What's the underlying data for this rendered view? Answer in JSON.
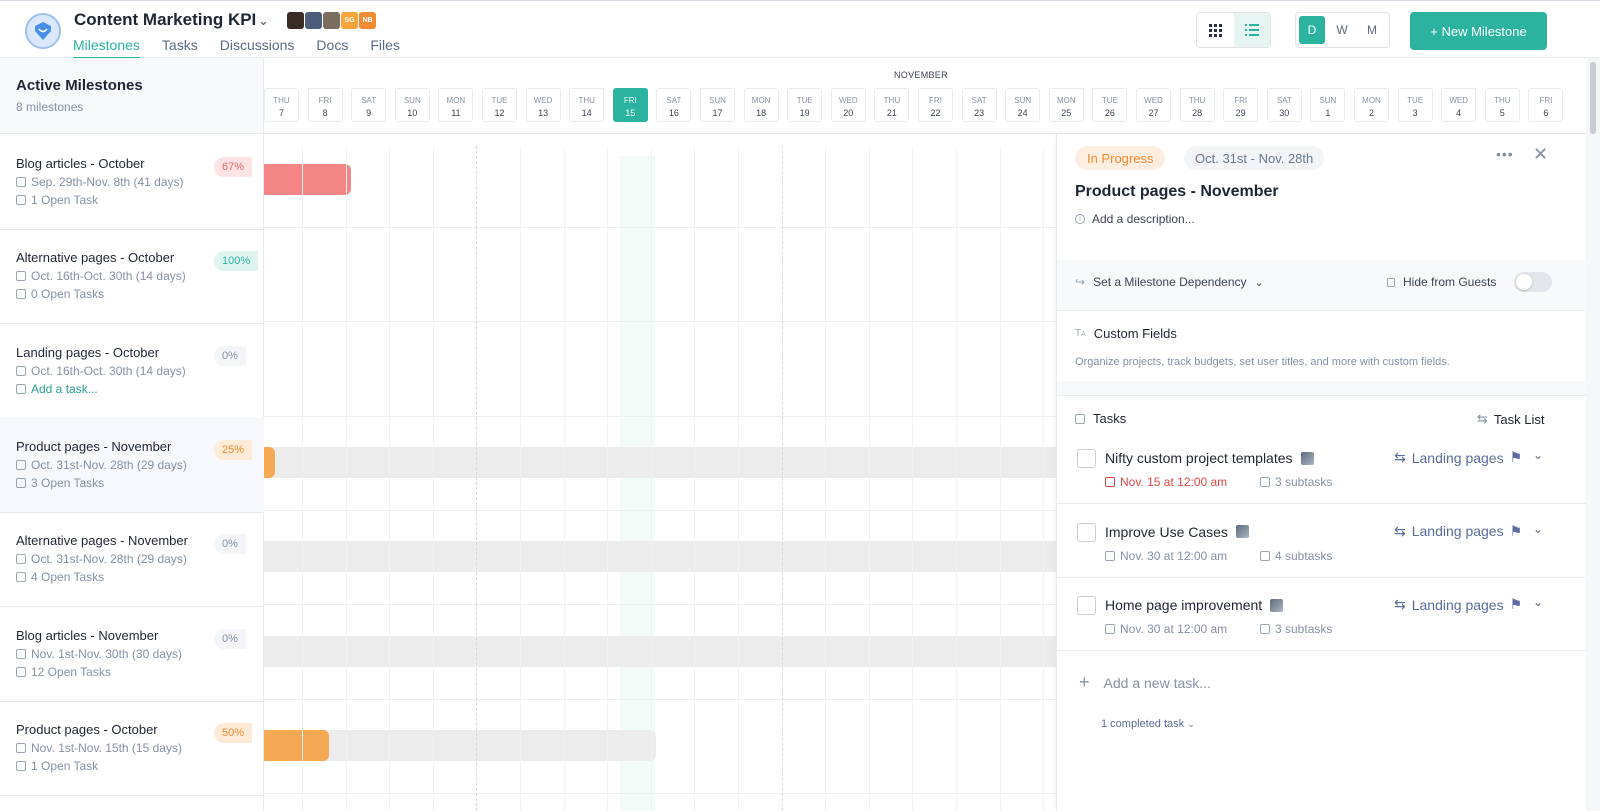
{
  "project": {
    "title": "Content Marketing KPI",
    "avatars": [
      {
        "initials": "",
        "color": "#3a2b25"
      },
      {
        "initials": "",
        "color": "#4b5d7a"
      },
      {
        "initials": "",
        "color": "#7a6d5f"
      },
      {
        "initials": "SG",
        "color": "#f6a33a"
      },
      {
        "initials": "NB",
        "color": "#f28a32"
      }
    ]
  },
  "nav": {
    "tabs": [
      {
        "label": "Milestones",
        "active": true
      },
      {
        "label": "Tasks",
        "active": false
      },
      {
        "label": "Discussions",
        "active": false
      },
      {
        "label": "Docs",
        "active": false
      },
      {
        "label": "Files",
        "active": false
      }
    ]
  },
  "toolbar": {
    "zoom": [
      "D",
      "W",
      "M"
    ],
    "zoom_selected": "D",
    "new_milestone": "+ New Milestone"
  },
  "sidebar": {
    "heading": "Active Milestones",
    "count": "8 milestones",
    "milestones": [
      {
        "name": "Blog articles - October",
        "dates": "Sep. 29th-Nov. 8th (41 days)",
        "tasks": "1 Open Task",
        "percent": "67%",
        "pct_bg": "#fde3e3",
        "pct_color": "#e86a6a",
        "bar_color": "#f48585",
        "bar_days": 2,
        "track_days": 0
      },
      {
        "name": "Alternative pages - October",
        "dates": "Oct. 16th-Oct. 30th (14 days)",
        "tasks": "0 Open Tasks",
        "percent": "100%",
        "pct_bg": "#dff4ef",
        "pct_color": "#2bb3a0",
        "bar_color": "#2bb3a0",
        "bar_days": 0,
        "track_days": 0
      },
      {
        "name": "Landing pages  - October",
        "dates": "Oct. 16th-Oct. 30th (14 days)",
        "tasks": "Add a task...",
        "task_is_link": true,
        "percent": "0%",
        "pct_bg": "#f3f5f8",
        "pct_color": "#8592a3",
        "bar_color": "#ececec",
        "bar_days": 0,
        "track_days": 0
      },
      {
        "name": "Product pages - November",
        "dates": "Oct. 31st-Nov. 28th (29 days)",
        "tasks": "3 Open Tasks",
        "percent": "25%",
        "pct_bg": "#fdebd8",
        "pct_color": "#f28a32",
        "bar_color": "#f6a955",
        "bar_days": 0.25,
        "track_days": 20,
        "selected": true
      },
      {
        "name": "Alternative pages - November",
        "dates": "Oct. 31st-Nov. 28th (29 days)",
        "tasks": "4 Open Tasks",
        "percent": "0%",
        "pct_bg": "#f3f5f8",
        "pct_color": "#8592a3",
        "bar_color": "#ececec",
        "bar_days": 0,
        "track_days": 20
      },
      {
        "name": "Blog articles - November",
        "dates": "Nov. 1st-Nov. 30th (30 days)",
        "tasks": "12 Open Tasks",
        "percent": "0%",
        "pct_bg": "#f3f5f8",
        "pct_color": "#8592a3",
        "bar_color": "#ececec",
        "bar_days": 0,
        "track_days": 20
      },
      {
        "name": "Product pages - October",
        "dates": "Nov. 1st-Nov. 15th (15 days)",
        "tasks": "1 Open Task",
        "percent": "50%",
        "pct_bg": "#fdebd8",
        "pct_color": "#f28a32",
        "bar_color": "#f6a955",
        "bar_days": 1.5,
        "track_days": 9
      }
    ]
  },
  "timeline": {
    "month_label": "NOVEMBER",
    "days": [
      {
        "dow": "THU",
        "d": "7"
      },
      {
        "dow": "FRI",
        "d": "8"
      },
      {
        "dow": "SAT",
        "d": "9"
      },
      {
        "dow": "SUN",
        "d": "10"
      },
      {
        "dow": "MON",
        "d": "11"
      },
      {
        "dow": "TUE",
        "d": "12"
      },
      {
        "dow": "WED",
        "d": "13"
      },
      {
        "dow": "THU",
        "d": "14"
      },
      {
        "dow": "FRI",
        "d": "15",
        "today": true
      },
      {
        "dow": "SAT",
        "d": "16"
      },
      {
        "dow": "SUN",
        "d": "17"
      },
      {
        "dow": "MON",
        "d": "18"
      },
      {
        "dow": "TUE",
        "d": "19"
      },
      {
        "dow": "WED",
        "d": "20"
      },
      {
        "dow": "THU",
        "d": "21"
      },
      {
        "dow": "FRI",
        "d": "22"
      },
      {
        "dow": "SAT",
        "d": "23"
      },
      {
        "dow": "SUN",
        "d": "24"
      },
      {
        "dow": "MON",
        "d": "25"
      },
      {
        "dow": "TUE",
        "d": "26"
      },
      {
        "dow": "WED",
        "d": "27"
      },
      {
        "dow": "THU",
        "d": "28"
      },
      {
        "dow": "FRI",
        "d": "29"
      },
      {
        "dow": "SAT",
        "d": "30"
      },
      {
        "dow": "SUN",
        "d": "1"
      },
      {
        "dow": "MON",
        "d": "2"
      },
      {
        "dow": "TUE",
        "d": "3"
      },
      {
        "dow": "WED",
        "d": "4"
      },
      {
        "dow": "THU",
        "d": "5"
      },
      {
        "dow": "FRI",
        "d": "6"
      }
    ]
  },
  "panel": {
    "status": "In Progress",
    "date_range": "Oct. 31st - Nov. 28th",
    "title": "Product pages - November",
    "description_placeholder": "Add a description...",
    "dependency": "Set a Milestone Dependency",
    "hide_from_guests": "Hide from Guests",
    "custom_fields_title": "Custom Fields",
    "custom_fields_desc": "Organize projects, track budgets, set user titles, and more with custom fields.",
    "tasks_heading": "Tasks",
    "task_list_label": "Task List",
    "tasks": [
      {
        "name": "Nifty custom project templates",
        "due": "Nov. 15 at 12:00 am",
        "overdue": true,
        "subtasks": "3 subtasks",
        "list": "Landing pages"
      },
      {
        "name": "Improve Use Cases",
        "due": "Nov. 30 at 12:00 am",
        "overdue": false,
        "subtasks": "4 subtasks",
        "list": "Landing pages"
      },
      {
        "name": "Home page improvement",
        "due": "Nov. 30 at 12:00 am",
        "overdue": false,
        "subtasks": "3 subtasks",
        "list": "Landing pages"
      }
    ],
    "add_task": "Add a new task...",
    "completed_toggle": "1 completed task"
  }
}
